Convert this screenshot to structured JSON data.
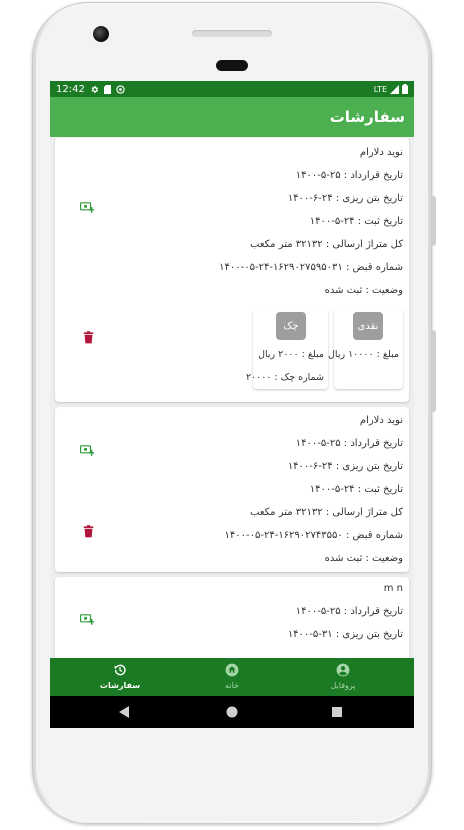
{
  "status": {
    "time": "12:42",
    "network": "LTE"
  },
  "appbar": {
    "title": "سفارشات"
  },
  "orders": [
    {
      "name": "نوید دلارام",
      "contract_date": "تاریخ قرارداد : ۲۵-۵-۱۴۰۰",
      "pour_date": "تاریخ بتن ریزی : ۲۴-۶-۱۴۰۰",
      "register_date": "تاریخ ثبت : ۲۴-۵-۱۴۰۰",
      "volume": "کل متراژ ارسالی : ۳۲۱۳۲ متر مکعب",
      "receipt": "شماره قبض : ۱۶۲۹۰۲۷۵۹۵۰۳۱-۲۴-۰۵-۱۴۰۰",
      "status": "وضعیت : ثبت شده",
      "payments": [
        {
          "type": "نقدی",
          "amount": "مبلغ : ۱۰۰۰۰ ریال"
        },
        {
          "type": "چک",
          "amount": "مبلغ : ۲۰۰۰ ریال",
          "check_number": "شماره چک : ۲۰۰۰۰"
        }
      ]
    },
    {
      "name": "نوید دلارام",
      "contract_date": "تاریخ قرارداد : ۲۵-۵-۱۴۰۰",
      "pour_date": "تاریخ بتن ریزی : ۲۴-۶-۱۴۰۰",
      "register_date": "تاریخ ثبت : ۲۴-۵-۱۴۰۰",
      "volume": "کل متراژ ارسالی : ۳۲۱۳۲ متر مکعب",
      "receipt": "شماره قبض : ۱۶۲۹۰۲۷۴۳۵۵۰-۲۴-۰۵-۱۴۰۰",
      "status": "وضعیت : ثبت شده"
    },
    {
      "name": "m n",
      "contract_date": "تاریخ قرارداد : ۲۵-۵-۱۴۰۰",
      "pour_date": "تاریخ بتن ریزی : ۳۱-۵-۱۴۰۰"
    }
  ],
  "bottom_nav": [
    {
      "label": "سفارشات",
      "icon": "history-icon",
      "active": true
    },
    {
      "label": "خانه",
      "icon": "home-icon",
      "active": false
    },
    {
      "label": "پروفایل",
      "icon": "account-icon",
      "active": false
    }
  ],
  "colors": {
    "appbar": "#4caf50",
    "statusbar": "#1b7a24",
    "bottom_nav": "#1b7a24",
    "trash": "#b0173a",
    "add_payment": "#2e9b3a",
    "chip": "#9e9e9e"
  }
}
